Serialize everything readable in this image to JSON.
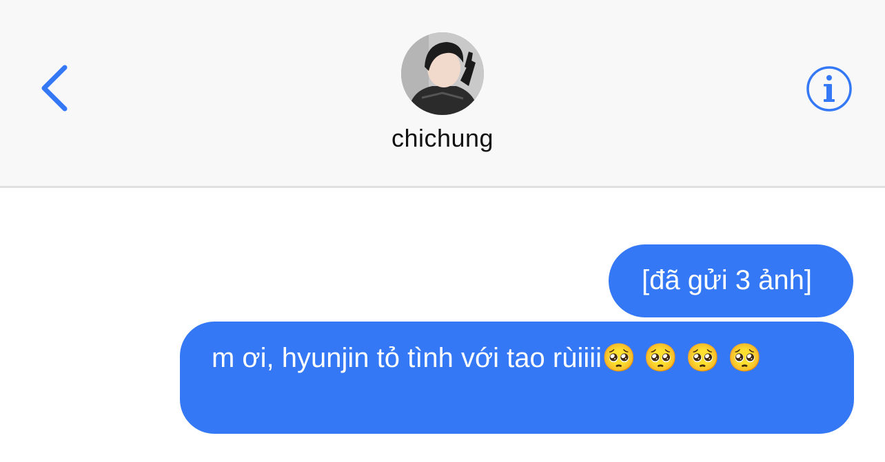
{
  "header": {
    "contact_name": "chichung",
    "back_icon": "chevron-left-icon",
    "info_icon": "info-circle-icon",
    "accent_color": "#3478f6"
  },
  "messages": [
    {
      "text": "[đã gửi 3 ảnh]",
      "sender": "me"
    },
    {
      "text": "m ơi, hyunjin tỏ tình với tao rùiiii🥺 🥺 🥺 🥺",
      "sender": "me"
    }
  ],
  "colors": {
    "bubble_outgoing": "#3478f6",
    "header_background": "#f8f8f8"
  }
}
